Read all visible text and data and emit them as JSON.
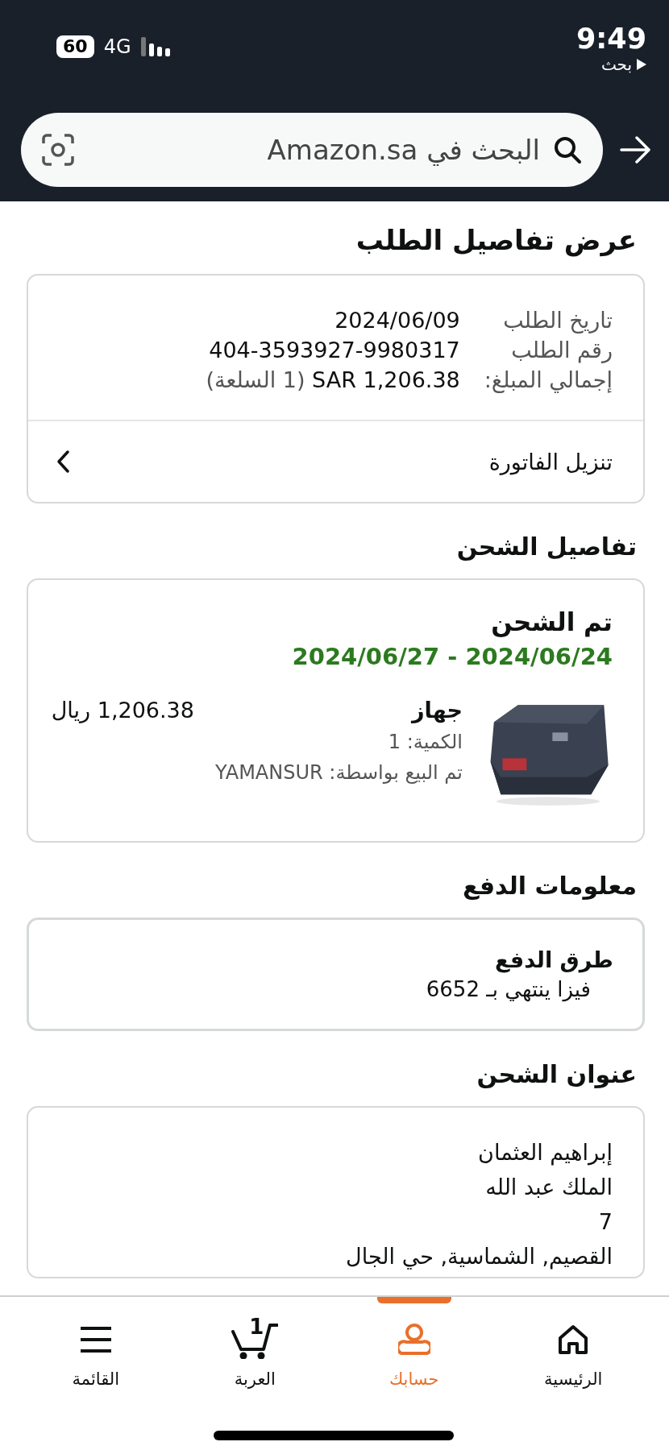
{
  "status_bar": {
    "time": "9:49",
    "back_label": "بحث",
    "network": "4G",
    "battery": "60"
  },
  "search": {
    "placeholder": "البحث في Amazon.sa"
  },
  "page_title": "عرض تفاصيل الطلب",
  "order_summary": {
    "rows": [
      {
        "label": "تاريخ الطلب",
        "value": "2024/06/09"
      },
      {
        "label": "رقم الطلب",
        "value": "404-3593927-9980317"
      },
      {
        "label": "إجمالي المبلغ:",
        "value": "SAR 1,206.38",
        "note": "(1 السلعة)"
      }
    ],
    "invoice_link": "تنزيل الفاتورة"
  },
  "shipping": {
    "heading": "تفاصيل الشحن",
    "status": "تم الشحن",
    "delivery_dates": "2024/06/24 - 2024/06/27",
    "item": {
      "name": "جهاز",
      "quantity": "الكمية: 1",
      "seller": "تم البيع بواسطة: YAMANSUR",
      "price": "1,206.38 ريال"
    }
  },
  "payment": {
    "heading": "معلومات الدفع",
    "method_title": "طرق الدفع",
    "method": "فيزا ينتهي بـ 6652"
  },
  "address": {
    "heading": "عنوان الشحن",
    "lines": [
      "إبراهيم العثمان",
      "الملك عبد الله",
      "7",
      "القصيم, الشماسية, حي الجال"
    ]
  },
  "nav": [
    {
      "kind": "home",
      "label": "الرئيسية",
      "selected": false
    },
    {
      "kind": "account",
      "label": "حسابك",
      "selected": true
    },
    {
      "kind": "cart",
      "label": "العربة",
      "selected": false,
      "badge": "1"
    },
    {
      "kind": "menu",
      "label": "القائمة",
      "selected": false
    }
  ]
}
